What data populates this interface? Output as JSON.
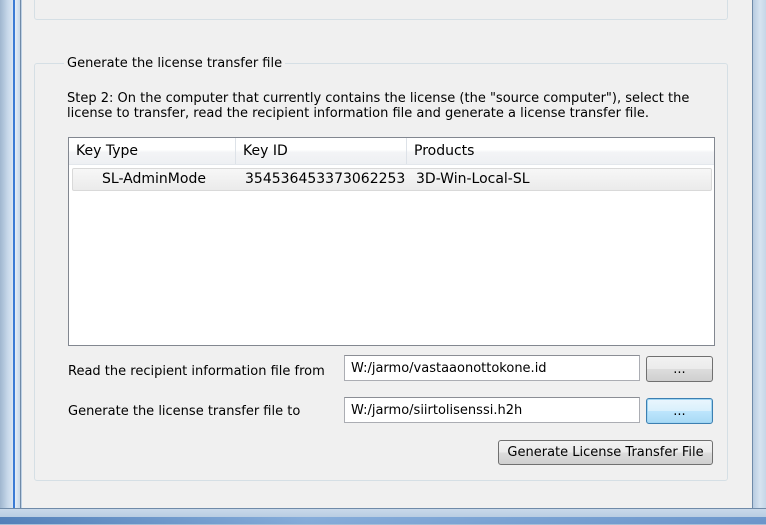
{
  "group": {
    "title": "Generate the license transfer file",
    "step_text": "Step 2: On the computer that currently contains the license (the \"source computer\"), select the license to transfer, read the recipient information file and generate a license transfer file."
  },
  "license_list": {
    "columns": [
      "Key Type",
      "Key ID",
      "Products"
    ],
    "rows": [
      {
        "key_type": "SL-AdminMode",
        "key_id": "354536453373062253",
        "products": "3D-Win-Local-SL"
      }
    ]
  },
  "recipient": {
    "label": "Read the recipient information file from",
    "value": "W:/jarmo/vastaaonottokone.id",
    "browse_label": "..."
  },
  "output": {
    "label": "Generate the license transfer file to",
    "value": "W:/jarmo/siirtolisenssi.h2h",
    "browse_label": "..."
  },
  "generate_button": {
    "label": "Generate License Transfer File"
  }
}
